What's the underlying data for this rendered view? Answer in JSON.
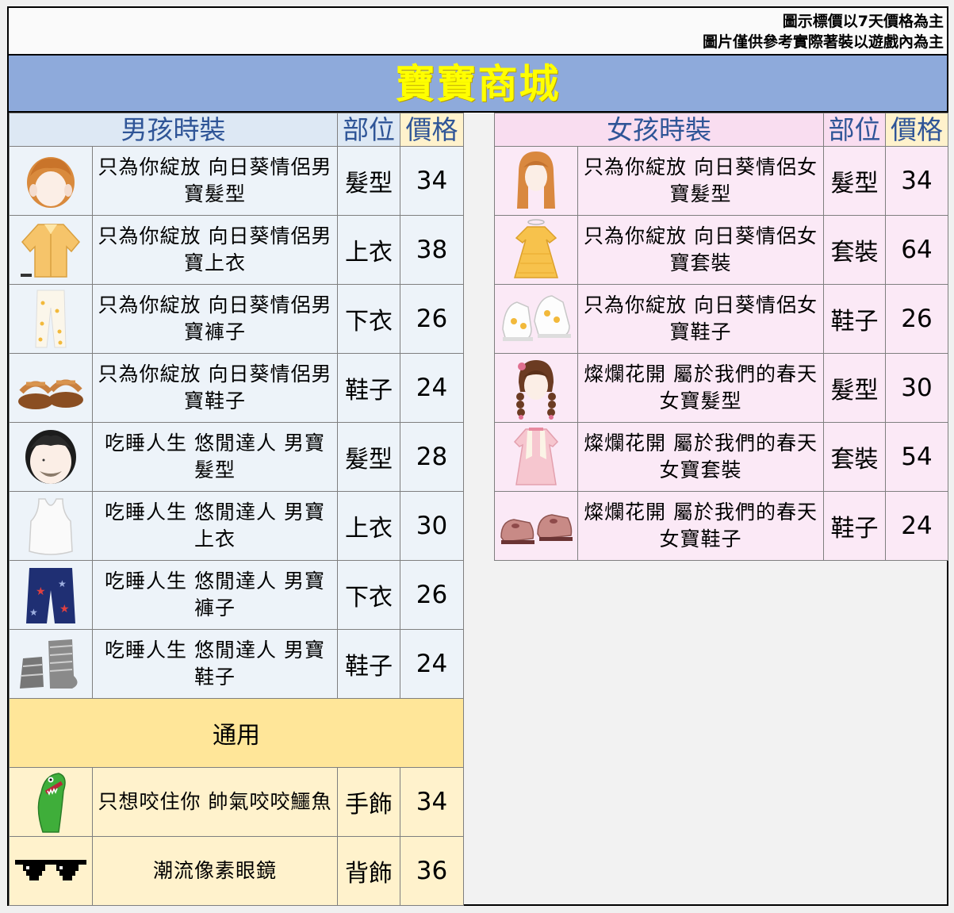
{
  "notes": {
    "line1": "圖示標價以7天價格為主",
    "line2": "圖片僅供參考實際著裝以遊戲內為主"
  },
  "title": "寶寶商城",
  "boys": {
    "header": {
      "name": "男孩時裝",
      "part": "部位",
      "price": "價格"
    },
    "items": [
      {
        "icon": "boy-sunflower-hair-icon",
        "name": "只為你綻放 向日葵情侶男寶髮型",
        "part": "髮型",
        "price": "34"
      },
      {
        "icon": "boy-sunflower-shirt-icon",
        "name": "只為你綻放 向日葵情侶男寶上衣",
        "part": "上衣",
        "price": "38"
      },
      {
        "icon": "boy-sunflower-pants-icon",
        "name": "只為你綻放 向日葵情侶男寶褲子",
        "part": "下衣",
        "price": "26"
      },
      {
        "icon": "boy-sunflower-sandals-icon",
        "name": "只為你綻放 向日葵情侶男寶鞋子",
        "part": "鞋子",
        "price": "24"
      },
      {
        "icon": "boy-uncle-hair-icon",
        "name": "吃睡人生 悠閒達人 男寶髮型",
        "part": "髮型",
        "price": "28"
      },
      {
        "icon": "boy-tank-top-icon",
        "name": "吃睡人生 悠閒達人 男寶上衣",
        "part": "上衣",
        "price": "30"
      },
      {
        "icon": "boy-star-shorts-icon",
        "name": "吃睡人生 悠閒達人 男寶褲子",
        "part": "下衣",
        "price": "26"
      },
      {
        "icon": "boy-socks-icon",
        "name": "吃睡人生 悠閒達人 男寶鞋子",
        "part": "鞋子",
        "price": "24"
      }
    ]
  },
  "common": {
    "header": "通用",
    "items": [
      {
        "icon": "crocodile-icon",
        "name": "只想咬住你 帥氣咬咬鱷魚",
        "part": "手飾",
        "price": "34"
      },
      {
        "icon": "pixel-sunglasses-icon",
        "name": "潮流像素眼鏡",
        "part": "背飾",
        "price": "36"
      }
    ]
  },
  "girls": {
    "header": {
      "name": "女孩時裝",
      "part": "部位",
      "price": "價格"
    },
    "items": [
      {
        "icon": "girl-sunflower-hair-icon",
        "name": "只為你綻放 向日葵情侶女寶髮型",
        "part": "髮型",
        "price": "34"
      },
      {
        "icon": "girl-sunflower-dress-icon",
        "name": "只為你綻放 向日葵情侶女寶套裝",
        "part": "套裝",
        "price": "64"
      },
      {
        "icon": "girl-sunflower-sneakers-icon",
        "name": "只為你綻放 向日葵情侶女寶鞋子",
        "part": "鞋子",
        "price": "26"
      },
      {
        "icon": "girl-braid-hair-icon",
        "name": "燦爛花開 屬於我們的春天 女寶髮型",
        "part": "髮型",
        "price": "30"
      },
      {
        "icon": "girl-pink-dress-icon",
        "name": "燦爛花開 屬於我們的春天 女寶套裝",
        "part": "套裝",
        "price": "54"
      },
      {
        "icon": "girl-pink-shoes-icon",
        "name": "燦爛花開 屬於我們的春天 女寶鞋子",
        "part": "鞋子",
        "price": "24"
      }
    ]
  }
}
